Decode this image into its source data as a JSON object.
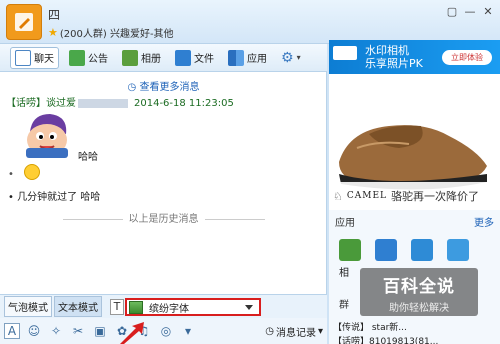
{
  "window": {
    "title": "四",
    "subtitle": "(200人群) 兴趣爱好-其他",
    "controls": [
      "▢",
      "—",
      "✕"
    ]
  },
  "tabs": [
    {
      "label": "聊天",
      "icon": "chat-icon",
      "active": true
    },
    {
      "label": "公告",
      "icon": "announcement-icon"
    },
    {
      "label": "相册",
      "icon": "album-icon"
    },
    {
      "label": "文件",
      "icon": "folder-icon"
    },
    {
      "label": "应用",
      "icon": "apps-icon"
    },
    {
      "label": "",
      "icon": "gear-icon"
    }
  ],
  "chat": {
    "more_link": "查看更多消息",
    "message_prefix": "【话唠】谈过爱",
    "message_time": "2014-6-18 11:23:05",
    "message_text": "哈哈",
    "bullet1": "•",
    "bullet2": "• 几分钟就过了 哈哈",
    "history_divider": "以上是历史消息"
  },
  "mode_bar": {
    "bubble_mode": "气泡模式",
    "text_mode": "文本模式",
    "font_T": "T",
    "font_name": "缤纷字体"
  },
  "bottom_bar": {
    "history_label": "消息记录"
  },
  "right_panel": {
    "ad_banner_text": "水印相机\n乐享照片PK",
    "ad_banner_btn": "立即体验",
    "camel_logo": "CAMEL",
    "camel_slogan": "骆驼再一次降价了",
    "app_header": "应用",
    "app_more": "更多",
    "app_label": "相",
    "members_label": "群",
    "member1": "【传说】 star新...",
    "member2": "【话唠】81019813(81..."
  },
  "watermark": {
    "main": "百科全说",
    "sub": "助你轻松解决"
  },
  "colors": {
    "accent_blue": "#1f63b8",
    "highlight_red": "#d81e1e",
    "avatar_orange": "#f19a1c"
  }
}
